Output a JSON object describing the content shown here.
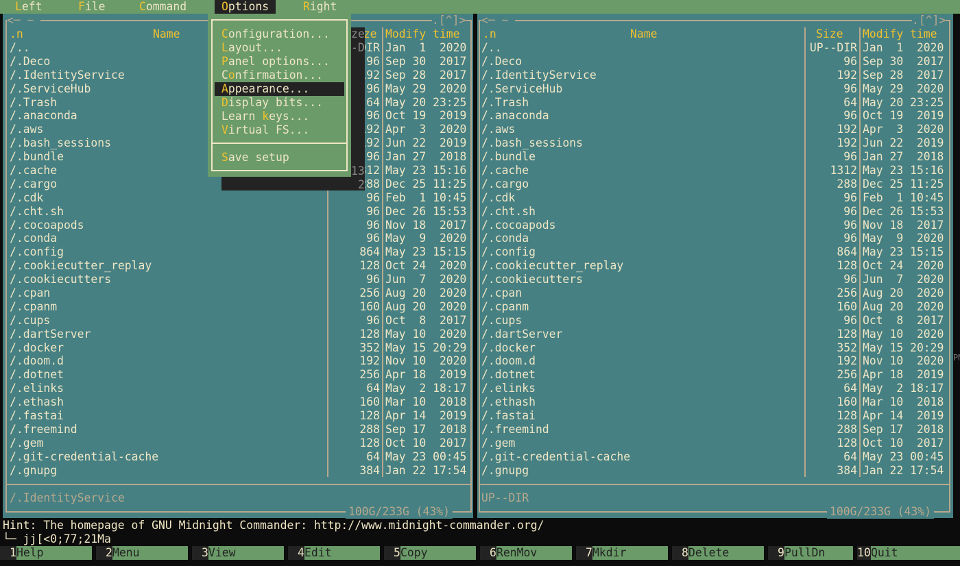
{
  "menubar": {
    "items": [
      {
        "hot": "L",
        "rest": "eft"
      },
      {
        "hot": "F",
        "rest": "ile"
      },
      {
        "hot": "C",
        "rest": "ommand"
      },
      {
        "hot": "O",
        "rest": "ptions",
        "active": true
      },
      {
        "hot": "R",
        "rest": "ight"
      }
    ]
  },
  "options_menu": {
    "items": [
      {
        "pre": "",
        "hot": "C",
        "rest": "onfiguration..."
      },
      {
        "pre": "",
        "hot": "L",
        "rest": "ayout..."
      },
      {
        "pre": "",
        "hot": "P",
        "rest": "anel options..."
      },
      {
        "pre": "C",
        "hot": "o",
        "rest": "nfirmation..."
      },
      {
        "pre": "",
        "hot": "A",
        "rest": "ppearance...",
        "selected": true
      },
      {
        "pre": "",
        "hot": "D",
        "rest": "isplay bits..."
      },
      {
        "pre": "Learn ",
        "hot": "k",
        "rest": "eys..."
      },
      {
        "pre": "",
        "hot": "V",
        "rest": "irtual FS..."
      }
    ],
    "save": {
      "pre": "",
      "hot": "S",
      "rest": "ave setup"
    }
  },
  "left_panel": {
    "path": "~",
    "left_corner": "<─",
    "top_right": ".[^]>",
    "headers": {
      "sort": ".n",
      "name": "Name",
      "size": "Size",
      "mtime": "Modify time"
    },
    "status_line": "/.IdentityService",
    "disk": "100G/233G (43%)"
  },
  "right_panel": {
    "path": "~",
    "left_corner": "<─",
    "top_right": ".[^]>",
    "headers": {
      "sort": ".n",
      "name": "Name",
      "size": "Size",
      "mtime": "Modify time"
    },
    "status_line": "UP--DIR",
    "disk": "100G/233G (43%)"
  },
  "files": [
    {
      "name": "/..",
      "size": "UP--DIR",
      "mtime": "Jan  1  2020"
    },
    {
      "name": "/.Deco",
      "size": "96",
      "mtime": "Sep 30  2017"
    },
    {
      "name": "/.IdentityService",
      "size": "192",
      "mtime": "Sep 28  2017"
    },
    {
      "name": "/.ServiceHub",
      "size": "96",
      "mtime": "May 29  2020"
    },
    {
      "name": "/.Trash",
      "size": "64",
      "mtime": "May 20 23:25"
    },
    {
      "name": "/.anaconda",
      "size": "96",
      "mtime": "Oct 19  2019"
    },
    {
      "name": "/.aws",
      "size": "192",
      "mtime": "Apr  3  2020"
    },
    {
      "name": "/.bash_sessions",
      "size": "192",
      "mtime": "Jun 22  2019"
    },
    {
      "name": "/.bundle",
      "size": "96",
      "mtime": "Jan 27  2018"
    },
    {
      "name": "/.cache",
      "size": "1312",
      "mtime": "May 23 15:16"
    },
    {
      "name": "/.cargo",
      "size": "288",
      "mtime": "Dec 25 11:25"
    },
    {
      "name": "/.cdk",
      "size": "96",
      "mtime": "Feb  1 10:45"
    },
    {
      "name": "/.cht.sh",
      "size": "96",
      "mtime": "Dec 26 15:53"
    },
    {
      "name": "/.cocoapods",
      "size": "96",
      "mtime": "Nov 18  2017"
    },
    {
      "name": "/.conda",
      "size": "96",
      "mtime": "May  9  2020"
    },
    {
      "name": "/.config",
      "size": "864",
      "mtime": "May 23 15:15"
    },
    {
      "name": "/.cookiecutter_replay",
      "size": "128",
      "mtime": "Oct 24  2020"
    },
    {
      "name": "/.cookiecutters",
      "size": "96",
      "mtime": "Jun  7  2020"
    },
    {
      "name": "/.cpan",
      "size": "256",
      "mtime": "Aug 20  2020"
    },
    {
      "name": "/.cpanm",
      "size": "160",
      "mtime": "Aug 20  2020"
    },
    {
      "name": "/.cups",
      "size": "96",
      "mtime": "Oct  8  2017"
    },
    {
      "name": "/.dartServer",
      "size": "128",
      "mtime": "May 10  2020"
    },
    {
      "name": "/.docker",
      "size": "352",
      "mtime": "May 15 20:29"
    },
    {
      "name": "/.doom.d",
      "size": "192",
      "mtime": "Nov 10  2020"
    },
    {
      "name": "/.dotnet",
      "size": "256",
      "mtime": "Apr 18  2019"
    },
    {
      "name": "/.elinks",
      "size": "64",
      "mtime": "May  2 18:17"
    },
    {
      "name": "/.ethash",
      "size": "160",
      "mtime": "Mar 10  2018"
    },
    {
      "name": "/.fastai",
      "size": "128",
      "mtime": "Apr 14  2019"
    },
    {
      "name": "/.freemind",
      "size": "288",
      "mtime": "Sep 17  2018"
    },
    {
      "name": "/.gem",
      "size": "128",
      "mtime": "Oct 10  2017"
    },
    {
      "name": "/.git-credential-cache",
      "size": "64",
      "mtime": "May 23 00:45"
    },
    {
      "name": "/.gnupg",
      "size": "384",
      "mtime": "Jan 22 17:54"
    }
  ],
  "hint": "Hint: The homepage of GNU Midnight Commander: http://www.midnight-commander.org/",
  "command_line": "└─ jj[<0;77;21Ma",
  "fkeys": [
    {
      "num": "1",
      "label": "Help"
    },
    {
      "num": "2",
      "label": "Menu"
    },
    {
      "num": "3",
      "label": "View"
    },
    {
      "num": "4",
      "label": "Edit"
    },
    {
      "num": "5",
      "label": "Copy"
    },
    {
      "num": "6",
      "label": "RenMov"
    },
    {
      "num": "7",
      "label": "Mkdir"
    },
    {
      "num": "8",
      "label": "Delete"
    },
    {
      "num": "9",
      "label": "PullDn"
    },
    {
      "num": "10",
      "label": "Quit"
    }
  ],
  "edge_text": "PM",
  "colors": {
    "panel_bg": "#468083",
    "menubar_bg": "#6a9b68",
    "highlight_fg": "#f2c12e",
    "text_fg": "#efe6c4",
    "selected_bg": "#232323",
    "frame": "#b8a88c"
  }
}
